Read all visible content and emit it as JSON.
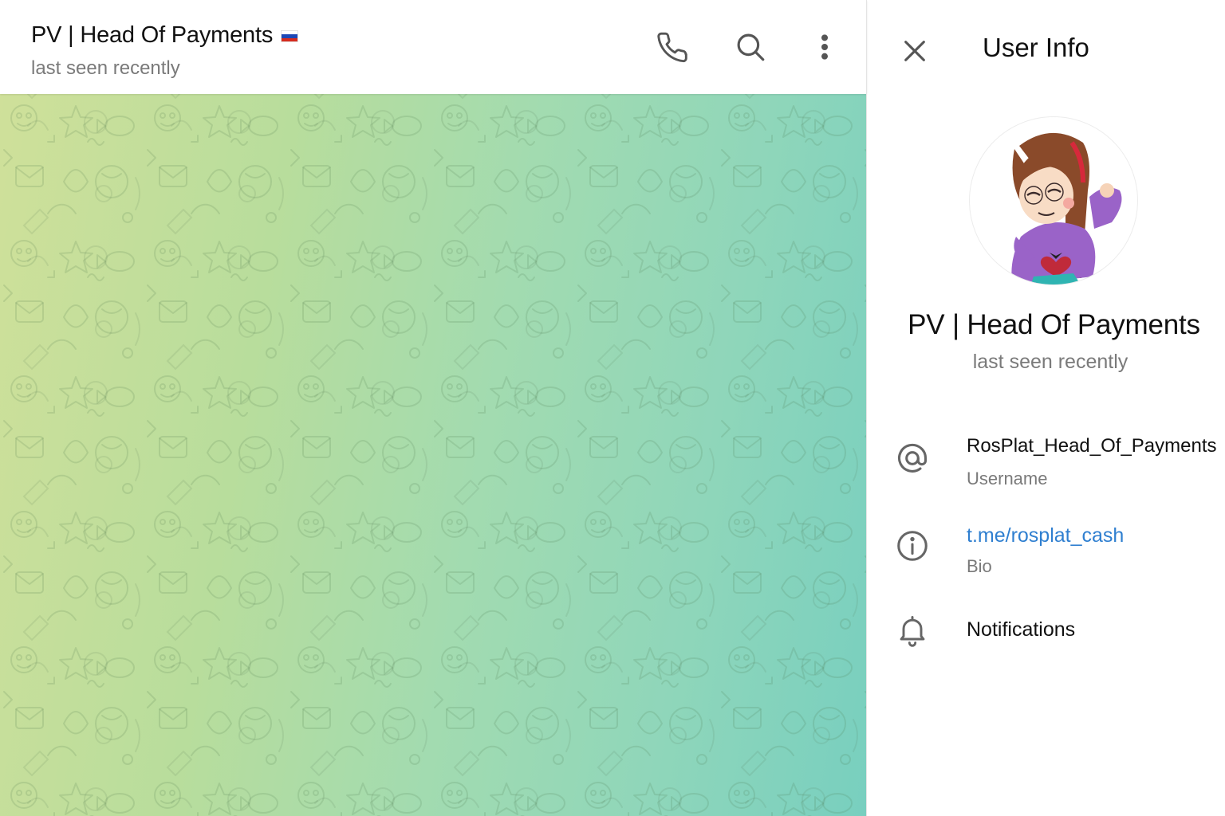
{
  "chat_header": {
    "title": "PV | Head Of Payments",
    "flag": "russia-flag",
    "status": "last seen recently",
    "icons": [
      "phone-icon",
      "search-icon",
      "more-vertical-icon"
    ]
  },
  "panel": {
    "title": "User Info",
    "close_icon": "close-icon",
    "profile": {
      "name": "PV | Head Of Payments",
      "status": "last seen recently",
      "avatar": "cartoon-girl-avatar"
    },
    "rows": {
      "username": {
        "icon": "at-icon",
        "value": "RosPlat_Head_Of_Payments",
        "label": "Username"
      },
      "bio": {
        "icon": "info-icon",
        "value": "t.me/rosplat_cash",
        "label": "Bio"
      },
      "notifications": {
        "icon": "bell-icon",
        "label": "Notifications"
      }
    }
  },
  "colors": {
    "link": "#2f7fd0",
    "muted_text": "#7a7a7a",
    "wallpaper_start": "#cfe09a",
    "wallpaper_end": "#78cfbf"
  }
}
